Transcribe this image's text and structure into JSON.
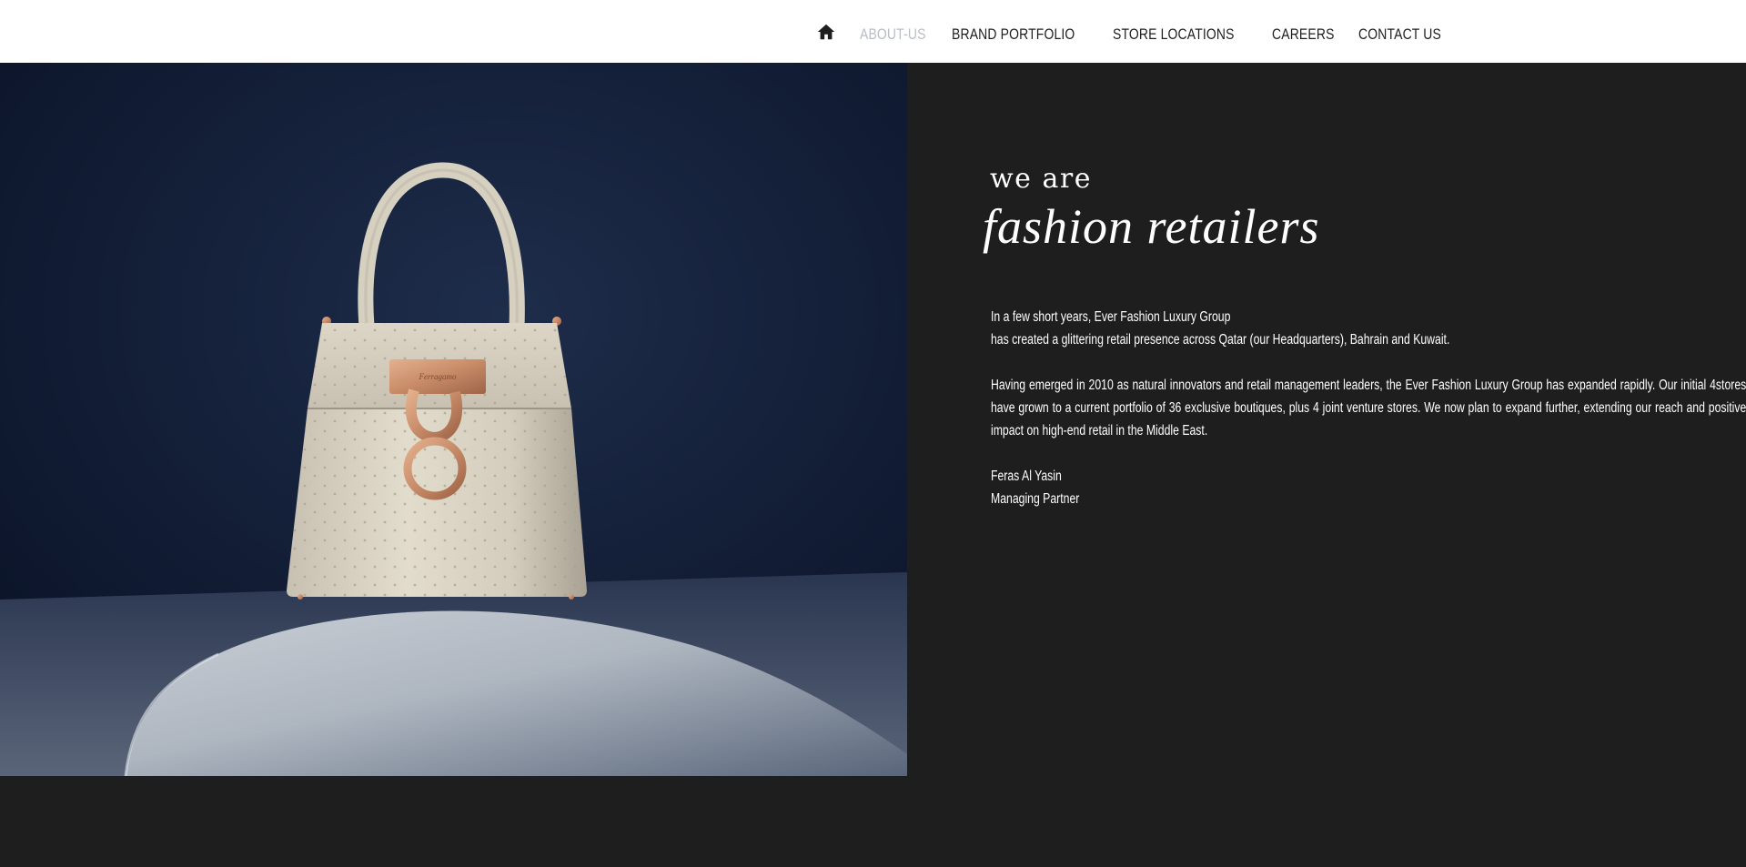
{
  "nav": {
    "home_icon": "home-icon",
    "items": [
      {
        "label": "ABOUT-US",
        "active": true
      },
      {
        "label": "BRAND PORTFOLIO",
        "active": false
      },
      {
        "label": "STORE LOCATIONS",
        "active": false
      },
      {
        "label": "CAREERS",
        "active": false
      },
      {
        "label": "CONTACT US",
        "active": false
      }
    ],
    "active_color": "#b9bcc4",
    "text_color": "#1e1e1e"
  },
  "hero": {
    "image": "handbag-photo",
    "background_color": "#0f1b31"
  },
  "intro": {
    "title_small": "we are",
    "title_big": "fashion retailers",
    "paragraph1_line1": "In a few short years, Ever Fashion Luxury Group",
    "paragraph1_line2": "has created a glittering retail presence across Qatar (our Headquarters), Bahrain and Kuwait.",
    "paragraph2": "Having emerged in 2010 as natural innovators and retail management leaders, the Ever Fashion Luxury Group has expanded rapidly. Our initial 4stores have grown to a current portfolio of 36 exclusive boutiques, plus 4 joint venture stores. We now plan to expand further, extending our reach and positive impact on high-end retail in the Middle East.",
    "signature_name": "Feras Al Yasin",
    "signature_title": "Managing Partner"
  },
  "colors": {
    "panel_background": "#1e1e1e",
    "text": "#ffffff"
  }
}
